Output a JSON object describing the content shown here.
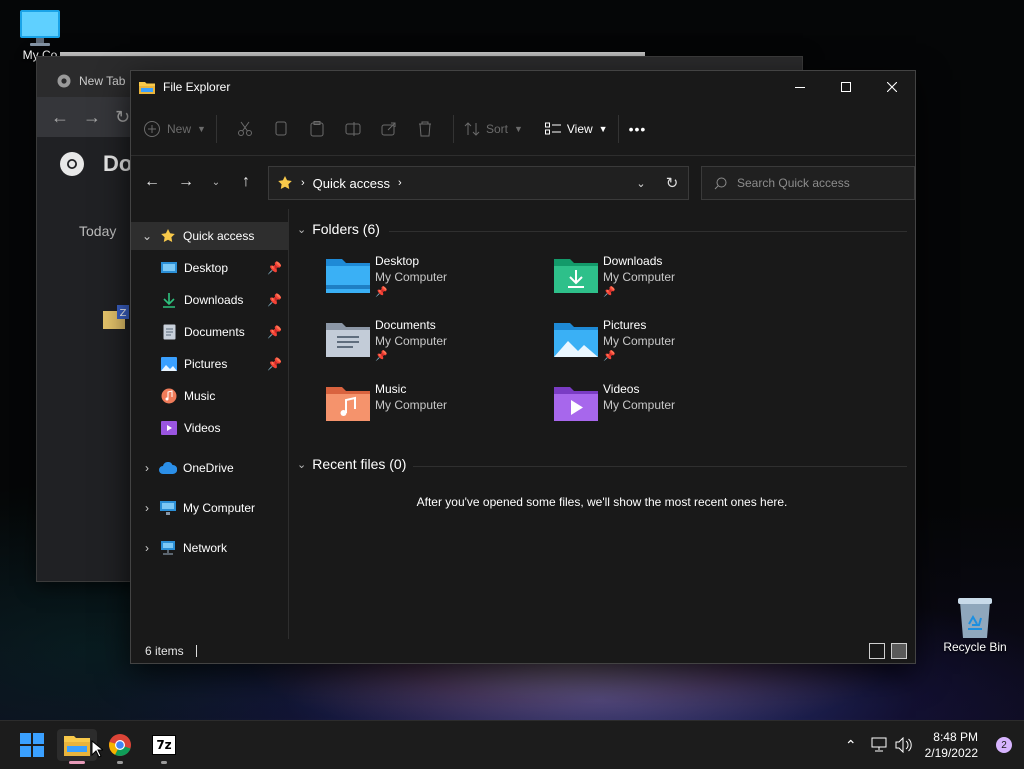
{
  "desktop": {
    "icons": [
      {
        "label": "My Co",
        "icon": "monitor-icon"
      },
      {
        "label": "Recycle Bin",
        "icon": "recycle-bin-icon"
      }
    ]
  },
  "chrome": {
    "tab_title": "New Tab",
    "page_heading": "Do",
    "today_label": "Today",
    "file_badge": "Z"
  },
  "explorer": {
    "title": "File Explorer",
    "commands": {
      "new": "New",
      "sort": "Sort",
      "view": "View",
      "more": "•••"
    },
    "address": {
      "location": "Quick access"
    },
    "search_placeholder": "Search Quick access",
    "sidebar": {
      "quick_access": "Quick access",
      "pinned": [
        {
          "label": "Desktop",
          "pinned": true
        },
        {
          "label": "Downloads",
          "pinned": true
        },
        {
          "label": "Documents",
          "pinned": true
        },
        {
          "label": "Pictures",
          "pinned": true
        },
        {
          "label": "Music",
          "pinned": false
        },
        {
          "label": "Videos",
          "pinned": false
        }
      ],
      "roots": [
        {
          "label": "OneDrive"
        },
        {
          "label": "My Computer"
        },
        {
          "label": "Network"
        }
      ]
    },
    "content": {
      "folders_header": "Folders (6)",
      "folders": [
        {
          "name": "Desktop",
          "location": "My Computer",
          "pinned": true,
          "icon": "desktop-folder-icon"
        },
        {
          "name": "Downloads",
          "location": "My Computer",
          "pinned": true,
          "icon": "downloads-folder-icon"
        },
        {
          "name": "Documents",
          "location": "My Computer",
          "pinned": true,
          "icon": "documents-folder-icon"
        },
        {
          "name": "Pictures",
          "location": "My Computer",
          "pinned": true,
          "icon": "pictures-folder-icon"
        },
        {
          "name": "Music",
          "location": "My Computer",
          "pinned": false,
          "icon": "music-folder-icon"
        },
        {
          "name": "Videos",
          "location": "My Computer",
          "pinned": false,
          "icon": "videos-folder-icon"
        }
      ],
      "recent_header": "Recent files (0)",
      "recent_empty": "After you've opened some files, we'll show the most recent ones here."
    },
    "status": {
      "items": "6 items"
    }
  },
  "taskbar": {
    "time": "8:48 PM",
    "date": "2/19/2022",
    "notifications": "2",
    "apps": [
      "start-button",
      "file-explorer",
      "chrome",
      "7zip"
    ],
    "sevenzip_label": "7z"
  },
  "colors": {
    "explorer_bg": "#191919",
    "taskbar_bg": "#1c1c1c",
    "windows_blue": "#3aa0ff",
    "folder_yellow": "#f8c94a",
    "notif_badge": "#d7b4ff"
  }
}
